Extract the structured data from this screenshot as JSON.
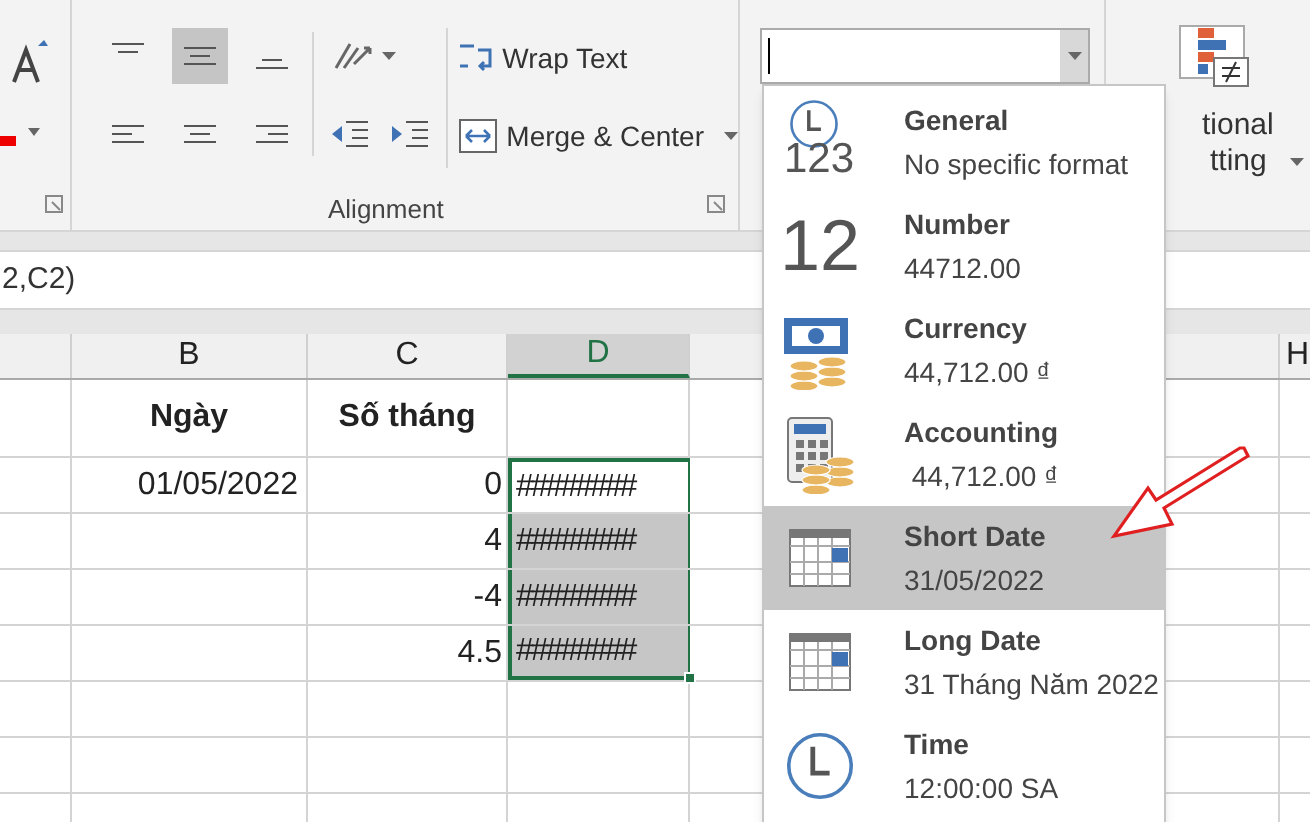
{
  "ribbon": {
    "alignment": {
      "label": "Alignment",
      "top_buttons": [
        {
          "kind": "top",
          "selected": false
        },
        {
          "kind": "middle",
          "selected": true
        },
        {
          "kind": "bottom",
          "selected": false
        }
      ],
      "bottom_buttons": [
        {
          "kind": "left",
          "selected": false
        },
        {
          "kind": "center",
          "selected": false
        },
        {
          "kind": "right",
          "selected": false
        }
      ],
      "wrap_text": "Wrap Text",
      "merge_center": "Merge & Center"
    },
    "conditional_formatting": {
      "line_1": "tional",
      "line_2": "tting"
    }
  },
  "formula_bar": {
    "text": "2,C2)"
  },
  "columns": [
    {
      "label": "B",
      "selected": false
    },
    {
      "label": "C",
      "selected": false
    },
    {
      "label": "D",
      "selected": true
    },
    {
      "label": "H",
      "selected": false
    }
  ],
  "rows": [
    {
      "b": "Ngày",
      "c": "Số tháng",
      "header": true
    },
    {
      "b": "01/05/2022",
      "c": "0",
      "d": {
        "text": "########",
        "active": true
      }
    },
    {
      "c": "4",
      "d": {
        "text": "########",
        "active": false
      }
    },
    {
      "c": "-4",
      "d": {
        "text": "########",
        "active": false
      }
    },
    {
      "c": "4.5",
      "d": {
        "text": "########",
        "active": false
      }
    }
  ],
  "format_menu": [
    {
      "kind": "general",
      "title": "General",
      "example": "No specific format",
      "icon_text": "123",
      "selected": false
    },
    {
      "kind": "number",
      "title": "Number",
      "example": "44712.00",
      "icon_text": "12",
      "selected": false
    },
    {
      "kind": "currency",
      "title": "Currency",
      "example": "44,712.00 ₫",
      "selected": false
    },
    {
      "kind": "accounting",
      "title": "Accounting",
      "example": " 44,712.00 ₫",
      "selected": false
    },
    {
      "kind": "date",
      "title": "Short Date",
      "example": "31/05/2022",
      "selected": true
    },
    {
      "kind": "date",
      "title": "Long Date",
      "example": "31 Tháng Năm 2022",
      "selected": false
    },
    {
      "kind": "time",
      "title": "Time",
      "example": "12:00:00 SA",
      "selected": false
    }
  ]
}
